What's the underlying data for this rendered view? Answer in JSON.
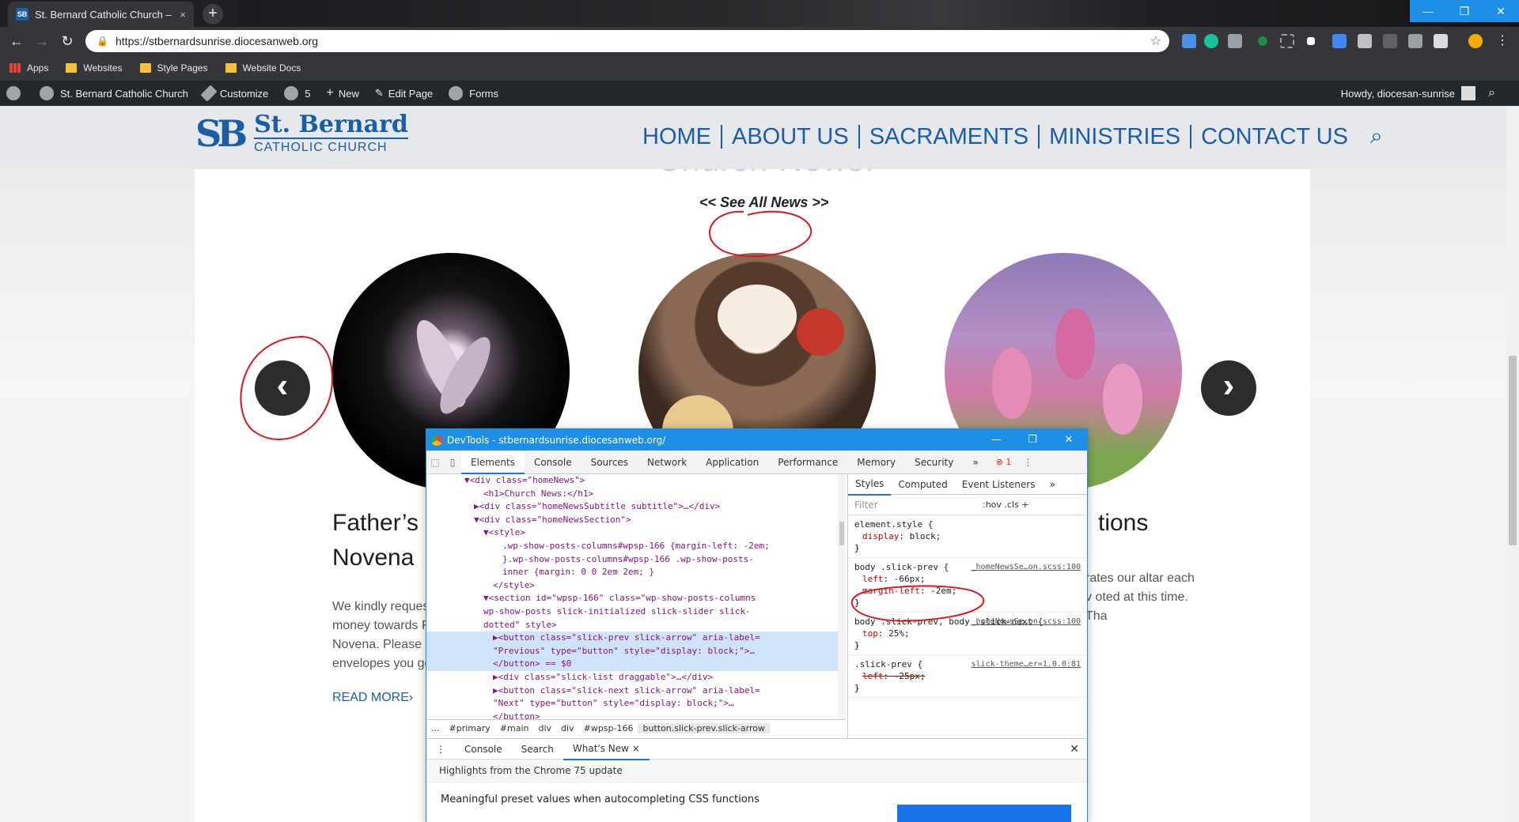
{
  "browser": {
    "tab_title": "St. Bernard Catholic Church – Su",
    "tab_close": "×",
    "new_tab": "+",
    "url": "https://stbernardsunrise.diocesanweb.org",
    "window_controls": {
      "minimize": "—",
      "maximize": "❐",
      "close": "✕"
    },
    "nav": {
      "back": "←",
      "forward": "→",
      "reload": "↻"
    },
    "bookmarks": [
      {
        "label": "Apps",
        "icon": "apps-grid-icon"
      },
      {
        "label": "Websites",
        "icon": "folder-icon"
      },
      {
        "label": "Style Pages",
        "icon": "folder-icon"
      },
      {
        "label": "Website Docs",
        "icon": "folder-icon"
      }
    ]
  },
  "adminbar": {
    "site_name": "St. Bernard Catholic Church",
    "customize": "Customize",
    "updates": "5",
    "new": "New",
    "edit_page": "Edit Page",
    "forms": "Forms",
    "howdy": "Howdy, diocesan-sunrise"
  },
  "site": {
    "logo_mark": "SB",
    "logo_line1": "St. Bernard",
    "logo_line2": "CATHOLIC CHURCH",
    "nav": [
      "HOME",
      "ABOUT US",
      "SACRAMENTS",
      "MINISTRIES",
      "CONTACT US"
    ],
    "section_title": "Church News:",
    "see_all": "<< See All News >>",
    "prev_arrow": "‹",
    "next_arrow": "›",
    "posts": [
      {
        "title_line1": "Father’s",
        "title_line2": "Novena",
        "excerpt": "We kindly reques money towards F Novena. Please u envelopes you ge",
        "read_more": "READ MORE›"
      },
      {
        "title_line1": "tions",
        "excerpt": "rates our altar each v oted at this time. Tha"
      }
    ]
  },
  "devtools": {
    "window_title": "DevTools - stbernardsunrise.diocesanweb.org/",
    "tabs": [
      "Elements",
      "Console",
      "Sources",
      "Network",
      "Application",
      "Performance",
      "Memory",
      "Security"
    ],
    "more_tabs": "»",
    "error_count": "1",
    "elements_lines": [
      {
        "indent": 4,
        "text": "▼<div class=\"homeNews\">"
      },
      {
        "indent": 6,
        "text": "<h1>Church News:</h1>"
      },
      {
        "indent": 5,
        "text": "▶<div class=\"homeNewsSubtitle subtitle\">…</div>"
      },
      {
        "indent": 5,
        "text": "▼<div class=\"homeNewsSection\">"
      },
      {
        "indent": 6,
        "text": "▼<style>"
      },
      {
        "indent": 8,
        "text": ".wp-show-posts-columns#wpsp-166 {margin-left: -2em;"
      },
      {
        "indent": 8,
        "text": "}.wp-show-posts-columns#wpsp-166 .wp-show-posts-"
      },
      {
        "indent": 8,
        "text": "inner {margin: 0 0 2em 2em; }"
      },
      {
        "indent": 7,
        "text": "</style>"
      },
      {
        "indent": 6,
        "text": "▼<section id=\"wpsp-166\" class=\"wp-show-posts-columns"
      },
      {
        "indent": 6,
        "text": "wp-show-posts slick-initialized slick-slider slick-"
      },
      {
        "indent": 6,
        "text": "dotted\" style>"
      },
      {
        "indent": 7,
        "text": "▶<button class=\"slick-prev slick-arrow\" aria-label=",
        "selected": true
      },
      {
        "indent": 7,
        "text": "\"Previous\" type=\"button\" style=\"display: block;\">…",
        "selected": true
      },
      {
        "indent": 7,
        "text": "</button> == $0",
        "selected": true
      },
      {
        "indent": 7,
        "text": "▶<div class=\"slick-list draggable\">…</div>"
      },
      {
        "indent": 7,
        "text": "▶<button class=\"slick-next slick-arrow\" aria-label="
      },
      {
        "indent": 7,
        "text": "\"Next\" type=\"button\" style=\"display: block;\">…"
      },
      {
        "indent": 7,
        "text": "</button>"
      }
    ],
    "breadcrumbs": [
      "...",
      "#primary",
      "#main",
      "div",
      "div",
      "#wpsp-166",
      "button.slick-prev.slick-arrow"
    ],
    "styles_tabs": [
      "Styles",
      "Computed",
      "Event Listeners"
    ],
    "filter_placeholder": "Filter",
    "filter_hov": ":hov",
    "filter_cls": ".cls",
    "filter_add": "+",
    "rules": [
      {
        "selector": "element.style {",
        "source": "",
        "props": [
          {
            "name": "display",
            "value": "block;"
          }
        ]
      },
      {
        "selector": "body .slick-prev {",
        "source": "_homeNewsSe…on.scss:100",
        "props": [
          {
            "name": "left",
            "value": "-66px;"
          },
          {
            "name": "margin-left",
            "value": "-2em;"
          }
        ]
      },
      {
        "selector": "body .slick-prev, body .slick-next {",
        "source": "_homeNewsSe…on.scss:100",
        "props": [
          {
            "name": "top",
            "value": "25%;"
          }
        ]
      },
      {
        "selector": ".slick-prev {",
        "source": "slick-theme…er=1.0.0:81",
        "props": [
          {
            "name": "left",
            "value": "-25px;",
            "struck": true
          }
        ]
      }
    ],
    "drawer_tabs": [
      "Console",
      "Search",
      "What's New"
    ],
    "drawer_close": "✕",
    "whatsnew_heading": "Highlights from the Chrome 75 update",
    "whatsnew_item": "Meaningful preset values when autocompleting CSS functions"
  },
  "colors": {
    "brand_blue": "#1a5ea8",
    "devtools_accent": "#1e8fe6",
    "annotation_red": "#e0141e"
  }
}
